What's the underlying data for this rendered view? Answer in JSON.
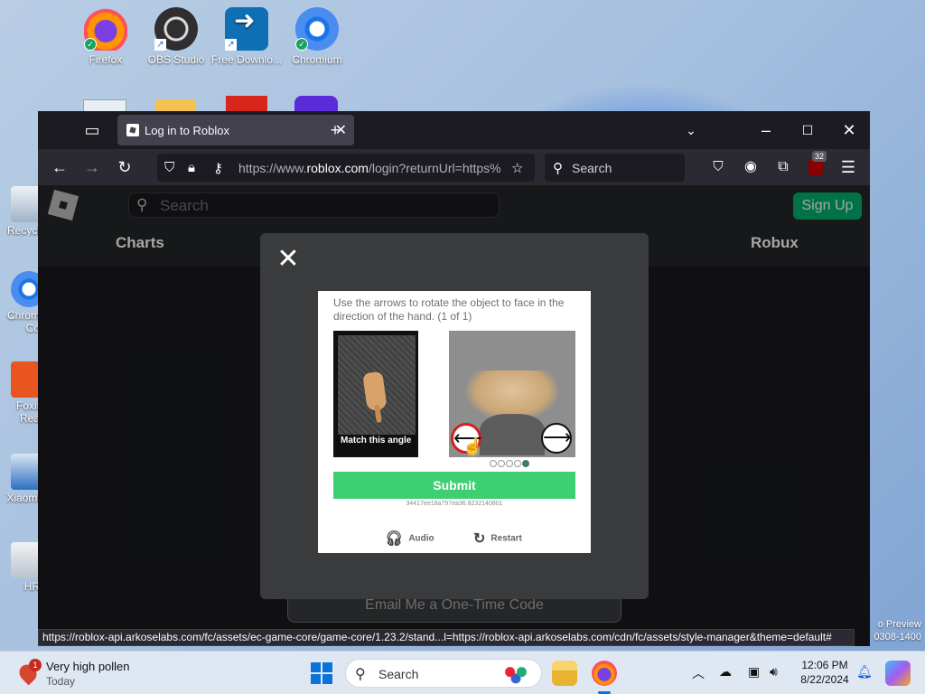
{
  "desktop": {
    "icons": [
      {
        "label": "Firefox"
      },
      {
        "label": "OBS Studio"
      },
      {
        "label": "Free Downlo..."
      },
      {
        "label": "Chromium"
      }
    ],
    "side_labels": {
      "recycle": "Recycl",
      "chrome1": "Chrom",
      "chrome2": "Co",
      "foxit1": "Foxit",
      "foxit2": "Rea",
      "xiaomi": "Xiaomi",
      "hr": "HR"
    },
    "preview_line1": "o Preview",
    "preview_line2": "0308-1400"
  },
  "browser": {
    "tab_title": "Log in to Roblox",
    "new_tab": "+",
    "url_prefix": "https://www.",
    "url_domain": "roblox.com",
    "url_path": "/login?returnUrl=https%",
    "search_placeholder": "Search",
    "ext_badge": "32",
    "status_url": "https://roblox-api.arkoselabs.com/fc/assets/ec-game-core/game-core/1.23.2/stand...l=https://roblox-api.arkoselabs.com/cdn/fc/assets/style-manager&theme=default#"
  },
  "roblox": {
    "search_placeholder": "Search",
    "signup": "Sign Up",
    "nav_charts": "Charts",
    "nav_robux": "Robux",
    "email_button": "Email Me a One-Time Code"
  },
  "captcha": {
    "close": "✕",
    "instruction": "Use the arrows to rotate the object to face in the direction of the hand. (1 of 1)",
    "ref_label": "Match this angle",
    "left_arrow": "⟵",
    "right_arrow": "⟶",
    "submit": "Submit",
    "session_id": "34417ee18a797ea36.8232140801",
    "audio": "Audio",
    "restart": "Restart"
  },
  "taskbar": {
    "weather_title": "Very high pollen",
    "weather_sub": "Today",
    "weather_badge": "1",
    "search_placeholder": "Search",
    "time": "12:06 PM",
    "date": "8/22/2024"
  }
}
